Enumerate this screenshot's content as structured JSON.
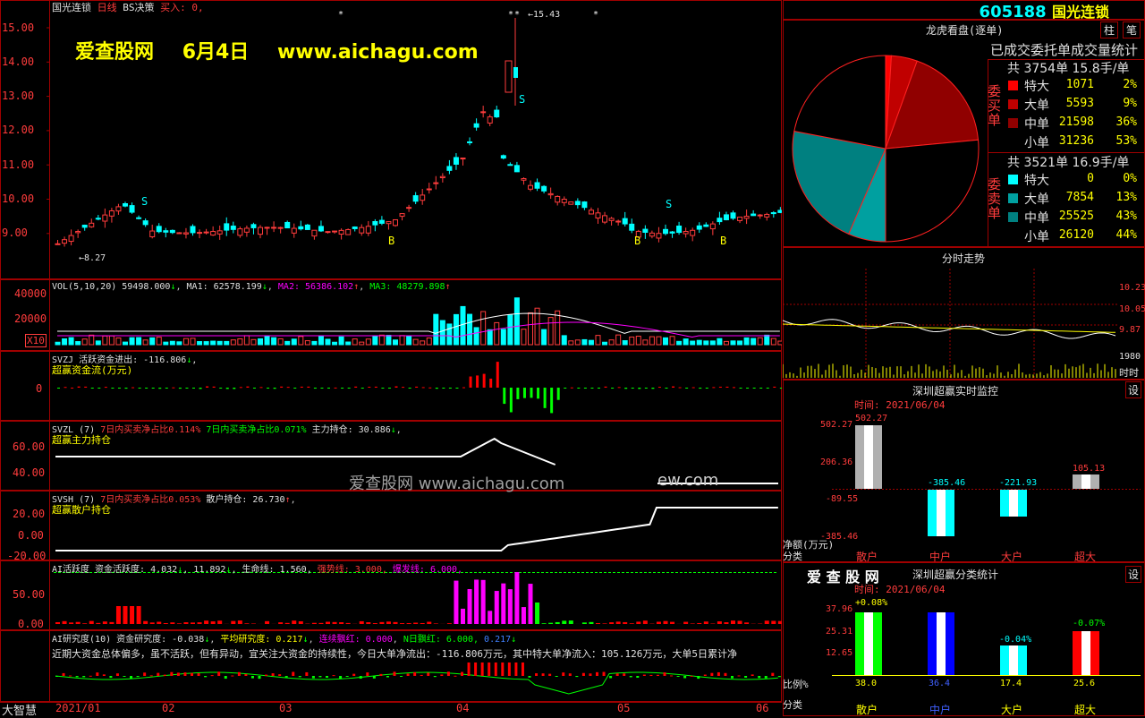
{
  "header": {
    "stock_name": "国光连锁",
    "period": "日线",
    "strategy": "BS决策",
    "buy_label": "买入: 0,",
    "code": "605188",
    "right_name": "国光连锁",
    "btn_zhu": "柱",
    "btn_bi": "笔"
  },
  "watermark": {
    "site": "爱查股网",
    "date": "6月4日",
    "url": "www.aichagu.com",
    "mid": "爱查股网  www.aichagu.com",
    "mid2": "ew.com"
  },
  "price_axis": [
    "15.00",
    "14.00",
    "13.00",
    "12.00",
    "11.00",
    "10.00",
    "9.00"
  ],
  "price_marks": {
    "high": "15.43",
    "low": "8.27",
    "signals_s": [
      "S",
      "S",
      "S"
    ],
    "signals_b": [
      "B",
      "B",
      "B"
    ]
  },
  "vol": {
    "line": "VOL(5,10,20) 59498.000",
    "ma1": "MA1: 62578.199",
    "ma2": "MA2: 56386.102",
    "ma3": "MA3: 48279.898",
    "axis": [
      "40000",
      "20000"
    ],
    "unit": "X10"
  },
  "svzj": {
    "title": "SVZJ  活跃资金进出: -116.806",
    "sub": "超赢资金流(万元)",
    "axis": [
      "0"
    ]
  },
  "svzl": {
    "title": "SVZL (7)",
    "t1": "7日内买卖净占比0.114%",
    "t2": "7日内买卖净占比0.071%",
    "t3": "主力持仓: 30.886",
    "sub": "超赢主力持仓",
    "axis": [
      "60.00",
      "40.00"
    ]
  },
  "svsh": {
    "title": "SVSH (7)",
    "t1": "7日内买卖净占比0.053%",
    "t2": "散户持仓: 26.730",
    "sub": "超赢散户持仓",
    "axis": [
      "20.00",
      "0.00",
      "-20.00"
    ]
  },
  "ai1": {
    "title": "AI活跃度 资金活跃度: 4.032",
    "v2": "11.892",
    "v3": "生命线: 1.560,",
    "v4": "强势线: 3.000,",
    "v5": "爆发线: 6.000,",
    "axis": [
      "50.00",
      "0.00"
    ]
  },
  "ai2": {
    "title": "AI研究度(10) 资金研究度: -0.038",
    "v2": "平均研究度: 0.217",
    "v3": "连续飘红: 0.000",
    "v4": "N日飘红: 6.000,",
    "v5": "0.217",
    "text": "近期大资金总体偏多，虽不活跃，但有异动，宜关注大资金的持续性，今日大单净流出：-116.806万元，其中特大单净流入：105.126万元，大单5日累计净"
  },
  "bottom": {
    "left": "大智慧",
    "months": [
      "2021/01",
      "02",
      "03",
      "04",
      "05",
      "06"
    ]
  },
  "dragon": {
    "title": "龙虎看盘(逐单)",
    "subtitle": "已成交委托单成交量统计",
    "buy_label": "委买单",
    "sell_label": "委卖单",
    "buy_total": "共 3754单 15.8手/单",
    "sell_total": "共 3521单 16.9手/单",
    "buy_rows": [
      {
        "name": "特大",
        "count": "1071",
        "pct": "2%",
        "color": "#ff0000"
      },
      {
        "name": "大单",
        "count": "5593",
        "pct": "9%",
        "color": "#c00000"
      },
      {
        "name": "中单",
        "count": "21598",
        "pct": "36%",
        "color": "#900000"
      },
      {
        "name": "小单",
        "count": "31236",
        "pct": "53%",
        "color": "#000000"
      }
    ],
    "sell_rows": [
      {
        "name": "特大",
        "count": "0",
        "pct": "0%",
        "color": "#00ffff"
      },
      {
        "name": "大单",
        "count": "7854",
        "pct": "13%",
        "color": "#00a0a0"
      },
      {
        "name": "中单",
        "count": "25525",
        "pct": "43%",
        "color": "#008080"
      },
      {
        "name": "小单",
        "count": "26120",
        "pct": "44%",
        "color": "#000000"
      }
    ]
  },
  "intraday": {
    "title": "分时走势",
    "axis": [
      "10.23",
      "10.05",
      "9.87"
    ],
    "vol": "1980",
    "time_label": "时时"
  },
  "monitor": {
    "title": "深圳超赢实时监控",
    "btn": "设",
    "time": "时间: 2021/06/04",
    "axis": [
      "502.27",
      "206.36",
      "-89.55",
      "-385.46"
    ],
    "values": [
      "502.27",
      "-385.46",
      "-221.93",
      "105.13"
    ],
    "cats": [
      "散户",
      "中户",
      "大户",
      "超大"
    ],
    "ylab1": "净额(万元)",
    "ylab2": "分类"
  },
  "stat": {
    "site": "爱 查 股 网",
    "title": "深圳超赢分类统计",
    "btn": "设",
    "time": "时间: 2021/06/04",
    "axis": [
      "37.96",
      "25.31",
      "12.65"
    ],
    "pct_labels": [
      "+0.08%",
      "",
      "-0.04%",
      "-0.07%"
    ],
    "values": [
      "38.0",
      "36.4",
      "17.4",
      "25.6"
    ],
    "cats": [
      "散户",
      "中户",
      "大户",
      "超大"
    ],
    "ylab1": "比例%",
    "ylab2": "分类"
  }
}
